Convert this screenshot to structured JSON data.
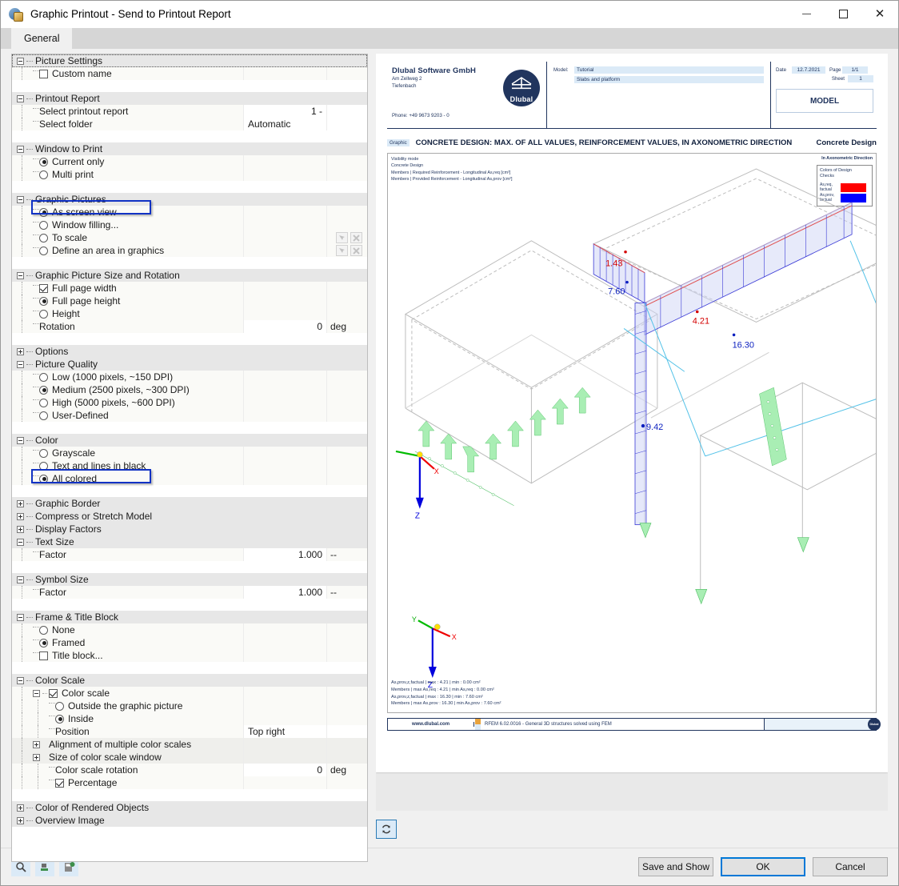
{
  "window": {
    "title": "Graphic Printout - Send to Printout Report",
    "icon": "graphic-printout-icon",
    "minimize": "–",
    "maximize": "□",
    "close": "✕"
  },
  "tabs": [
    {
      "label": "General",
      "active": true
    }
  ],
  "settings": {
    "groups": [
      {
        "name": "Picture Settings",
        "expanded": true,
        "highlight_dotted": true,
        "items": [
          {
            "type": "checkbox",
            "label": "Custom name",
            "checked": false
          }
        ]
      },
      {
        "name": "Printout Report",
        "expanded": true,
        "items": [
          {
            "type": "value",
            "label": "Select printout report",
            "value": "1 -"
          },
          {
            "type": "value",
            "label": "Select folder",
            "value": "Automatic"
          }
        ]
      },
      {
        "name": "Window to Print",
        "expanded": true,
        "items": [
          {
            "type": "radio",
            "label": "Current only",
            "checked": true
          },
          {
            "type": "radio",
            "label": "Multi print",
            "checked": false
          }
        ]
      },
      {
        "name": "Graphic Pictures",
        "expanded": true,
        "items": [
          {
            "type": "radio",
            "label": "As screen view",
            "checked": true,
            "highlighted": true
          },
          {
            "type": "radio",
            "label": "Window filling...",
            "checked": false
          },
          {
            "type": "radio",
            "label": "To scale",
            "checked": false
          },
          {
            "type": "radio",
            "label": "Define an area in graphics",
            "checked": false
          }
        ]
      },
      {
        "name": "Graphic Picture Size and Rotation",
        "expanded": true,
        "items": [
          {
            "type": "checkbox",
            "label": "Full page width",
            "checked": true
          },
          {
            "type": "radio",
            "label": "Full page height",
            "checked": true
          },
          {
            "type": "radio",
            "label": "Height",
            "checked": false
          },
          {
            "type": "value",
            "label": "Rotation",
            "value": "0",
            "unit": "deg"
          }
        ]
      },
      {
        "name": "Options",
        "expanded": false,
        "items": []
      },
      {
        "name": "Picture Quality",
        "expanded": true,
        "items": [
          {
            "type": "radio",
            "label": "Low (1000 pixels, ~150 DPI)",
            "checked": false
          },
          {
            "type": "radio",
            "label": "Medium (2500 pixels, ~300 DPI)",
            "checked": true
          },
          {
            "type": "radio",
            "label": "High (5000 pixels, ~600 DPI)",
            "checked": false
          },
          {
            "type": "radio",
            "label": "User-Defined",
            "checked": false
          }
        ]
      },
      {
        "name": "Color",
        "expanded": true,
        "items": [
          {
            "type": "radio",
            "label": "Grayscale",
            "checked": false
          },
          {
            "type": "radio",
            "label": "Text and lines in black",
            "checked": false
          },
          {
            "type": "radio",
            "label": "All colored",
            "checked": true,
            "highlighted": true
          }
        ]
      },
      {
        "name": "Graphic Border",
        "expanded": false,
        "items": []
      },
      {
        "name": "Compress or Stretch Model",
        "expanded": false,
        "items": []
      },
      {
        "name": "Display Factors",
        "expanded": false,
        "items": []
      },
      {
        "name": "Text Size",
        "expanded": true,
        "items": [
          {
            "type": "value",
            "label": "Factor",
            "value": "1.000",
            "unit": "--"
          }
        ]
      },
      {
        "name": "Symbol Size",
        "expanded": true,
        "items": [
          {
            "type": "value",
            "label": "Factor",
            "value": "1.000",
            "unit": "--"
          }
        ]
      },
      {
        "name": "Frame & Title Block",
        "expanded": true,
        "items": [
          {
            "type": "radio",
            "label": "None",
            "checked": false
          },
          {
            "type": "radio",
            "label": "Framed",
            "checked": true
          },
          {
            "type": "checkbox",
            "label": "Title block...",
            "checked": false
          }
        ]
      },
      {
        "name": "Color Scale",
        "expanded": true,
        "items": [
          {
            "type": "checkbox-parent",
            "label": "Color scale",
            "checked": true
          },
          {
            "type": "radio",
            "label": "Outside the graphic picture",
            "checked": false
          },
          {
            "type": "radio",
            "label": "Inside",
            "checked": true
          },
          {
            "type": "value",
            "label": "Position",
            "value": "Top right"
          },
          {
            "type": "subgroup",
            "label": "Alignment of multiple color scales"
          },
          {
            "type": "subgroup",
            "label": "Size of color scale window"
          },
          {
            "type": "value",
            "label": "Color scale rotation",
            "value": "0",
            "unit": "deg"
          },
          {
            "type": "checkbox",
            "label": "Percentage",
            "checked": true
          }
        ]
      },
      {
        "name": "Color of Rendered Objects",
        "expanded": false,
        "items": []
      },
      {
        "name": "Overview Image",
        "expanded": false,
        "items": []
      }
    ],
    "highlight_color": "#1132c4"
  },
  "preview": {
    "refresh_icon": "refresh-icon",
    "title_block": {
      "company_name": "Dlubal Software GmbH",
      "address_line1": "Am Zellweg 2",
      "address_line2": "Tiefenbach",
      "phone": "Phone: +49 9673 9203 - 0",
      "logo_text": "Dlubal",
      "model_key": "Model:",
      "model_value": "Tutorial",
      "model_desc": "Slabs and platform",
      "date_key": "Date",
      "date_value": "12.7.2021",
      "page_key": "Page",
      "page_value": "1/1",
      "sheet_key": "Sheet",
      "sheet_value": "1",
      "section_label": "MODEL"
    },
    "page_header": {
      "tag": "Graphic",
      "title": "CONCRETE DESIGN: MAX. OF ALL VALUES, REINFORCEMENT VALUES, IN AXONOMETRIC DIRECTION",
      "right_label": "Concrete Design"
    },
    "visibility": {
      "line1": "Visibility mode",
      "line2": "Concrete Design",
      "line3": "Members | Required Reinforcement - Longitudinal As,req [cm²]",
      "line4": "Members | Provided Reinforcement - Longitudinal As,prov [cm²]"
    },
    "legend": {
      "direction_label": "In Axonometric Direction",
      "title_line1": "Colors of Design",
      "title_line2": "Checks",
      "entries": [
        {
          "label": "As,req, factual",
          "color": "#ff0000"
        },
        {
          "label": "As,prov, factual",
          "color": "#0000ff"
        }
      ]
    },
    "model_labels": [
      {
        "text": "1.43",
        "color": "#d40000"
      },
      {
        "text": "7.60",
        "color": "#0b1fbf"
      },
      {
        "text": "4.21",
        "color": "#d40000"
      },
      {
        "text": "16.30",
        "color": "#0b1fbf"
      },
      {
        "text": "9.42",
        "color": "#0b1fbf"
      }
    ],
    "axes": {
      "x": "X",
      "y": "Y",
      "z": "Z"
    },
    "results": {
      "line1": "As,prov,z,factual | max : 4.21 | min : 0.00 cm²",
      "line2": "Members | max As,req : 4.21 | min As,req : 0.00 cm²",
      "line3": "As,prov,z,factual | max : 16.30 | min : 7.60 cm²",
      "line4": "Members | max As,prov : 16.30 | min As,prov : 7.60 cm²"
    },
    "footer": {
      "website": "www.dlubal.com",
      "program": "RFEM 6.02.0016 - General 3D structures solved using FEM",
      "logo_text": "Dlubal"
    }
  },
  "footer_bar": {
    "icons": [
      "zoom-icon",
      "print-preview-icon",
      "save-layout-icon"
    ],
    "buttons": [
      {
        "label": "Save and Show",
        "primary": false
      },
      {
        "label": "OK",
        "primary": true
      },
      {
        "label": "Cancel",
        "primary": false
      }
    ]
  }
}
